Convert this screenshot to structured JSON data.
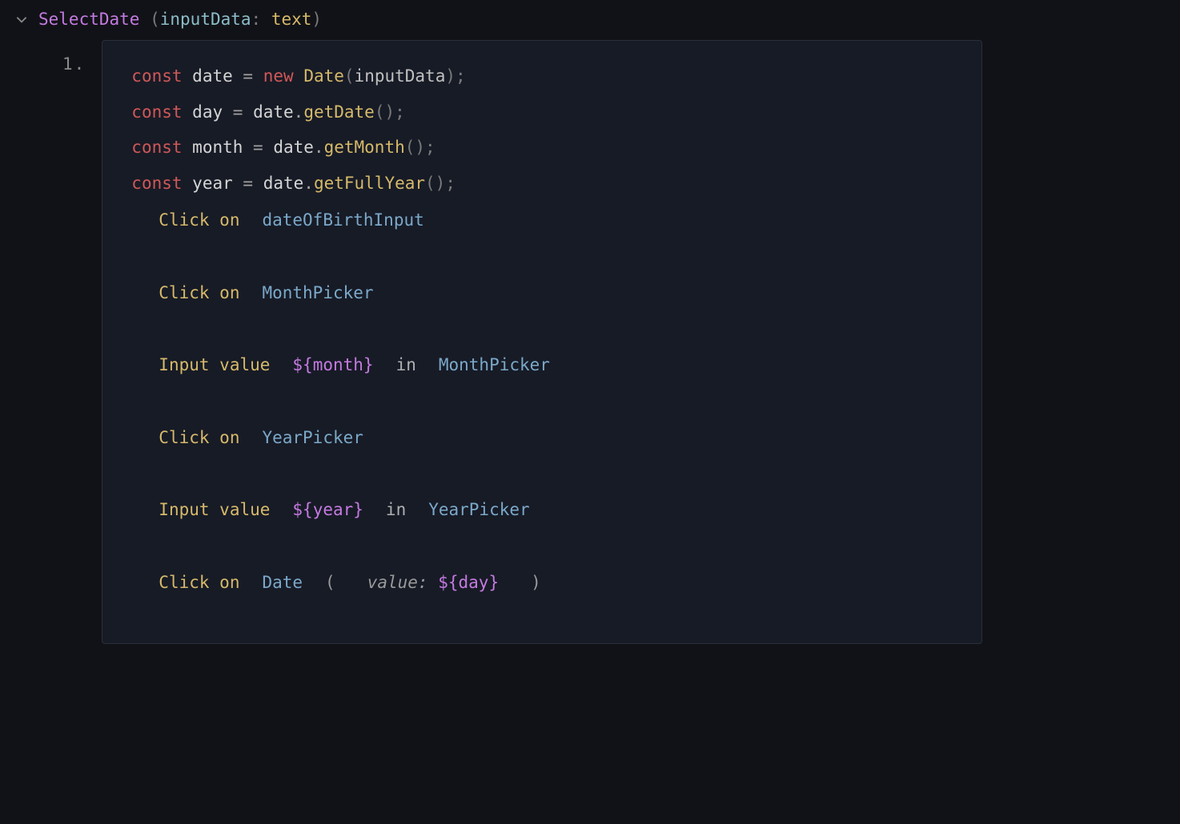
{
  "header": {
    "function_name": "SelectDate",
    "param_name": "inputData",
    "param_type": "text"
  },
  "step_number": "1.",
  "code": {
    "l1": {
      "kw": "const",
      "var": "date",
      "eq": "=",
      "new": "new",
      "cls": "Date",
      "arg": "inputData"
    },
    "l2": {
      "kw": "const",
      "var": "day",
      "eq": "=",
      "obj": "date",
      "method": "getDate"
    },
    "l3": {
      "kw": "const",
      "var": "month",
      "eq": "=",
      "obj": "date",
      "method": "getMonth"
    },
    "l4": {
      "kw": "const",
      "var": "year",
      "eq": "=",
      "obj": "date",
      "method": "getFullYear"
    }
  },
  "commands": {
    "c1": {
      "verb": "Click",
      "prep": "on",
      "target": "dateOfBirthInput"
    },
    "c2": {
      "verb": "Click",
      "prep": "on",
      "target": "MonthPicker"
    },
    "c3": {
      "verb": "Input",
      "noun": "value",
      "tpl": "month",
      "in": "in",
      "target": "MonthPicker"
    },
    "c4": {
      "verb": "Click",
      "prep": "on",
      "target": "YearPicker"
    },
    "c5": {
      "verb": "Input",
      "noun": "value",
      "tpl": "year",
      "in": "in",
      "target": "YearPicker"
    },
    "c6": {
      "verb": "Click",
      "prep": "on",
      "target": "Date",
      "arg_label": "value:",
      "tpl": "day"
    }
  }
}
